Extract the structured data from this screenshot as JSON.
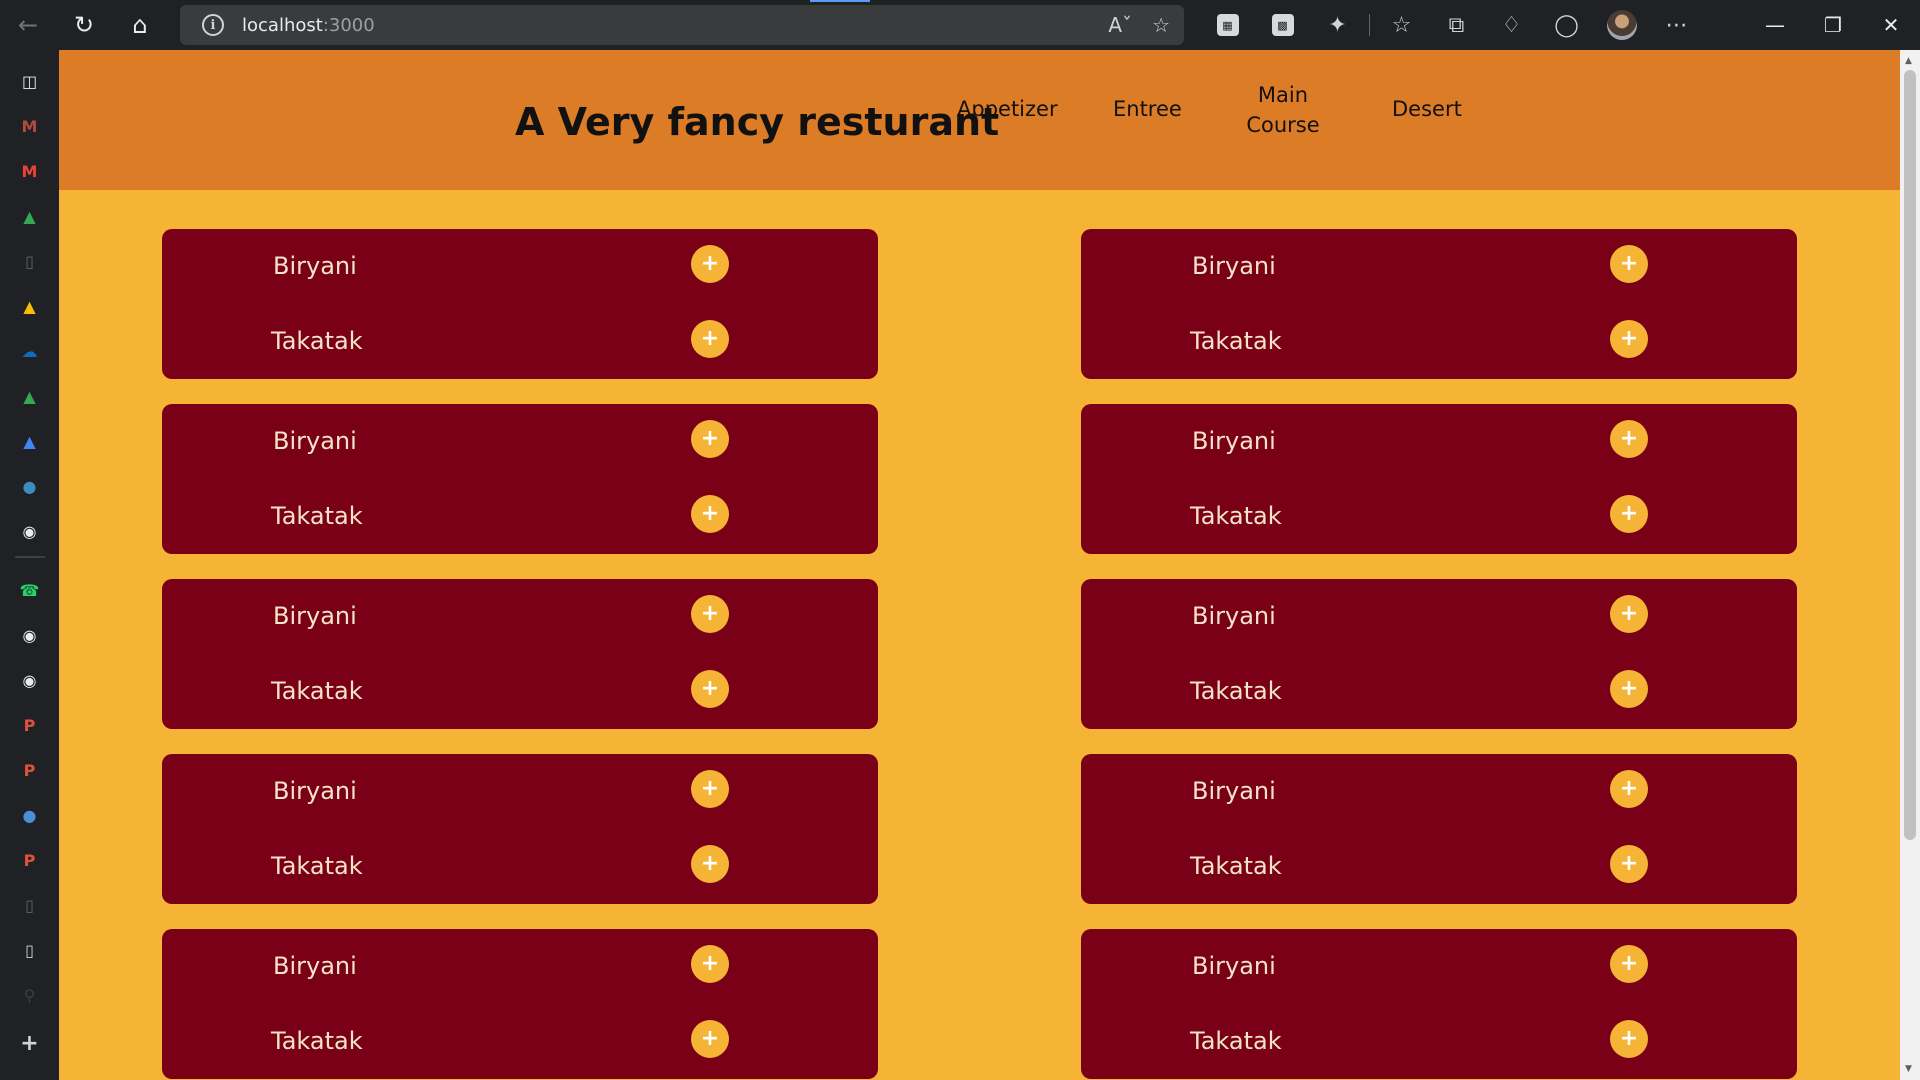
{
  "browser": {
    "url_host": "localhost",
    "url_port": ":3000"
  },
  "site": {
    "title": "A Very fancy resturant",
    "nav": [
      "Appetizer",
      "Entree",
      "Main Course",
      "Desert"
    ]
  },
  "menu": {
    "add_label": "+",
    "cards": [
      {
        "items": [
          "Biryani",
          "Takatak"
        ]
      },
      {
        "items": [
          "Biryani",
          "Takatak"
        ]
      },
      {
        "items": [
          "Biryani",
          "Takatak"
        ]
      },
      {
        "items": [
          "Biryani",
          "Takatak"
        ]
      },
      {
        "items": [
          "Biryani",
          "Takatak"
        ]
      },
      {
        "items": [
          "Biryani",
          "Takatak"
        ]
      },
      {
        "items": [
          "Biryani",
          "Takatak"
        ]
      },
      {
        "items": [
          "Biryani",
          "Takatak"
        ]
      },
      {
        "items": [
          "Biryani",
          "Takatak"
        ]
      },
      {
        "items": [
          "Biryani",
          "Takatak"
        ]
      }
    ]
  },
  "colors": {
    "header": "#dd7c27",
    "background": "#f6b436",
    "card": "#7a0017",
    "card_text": "#f4e4c7",
    "button": "#f6b436"
  }
}
